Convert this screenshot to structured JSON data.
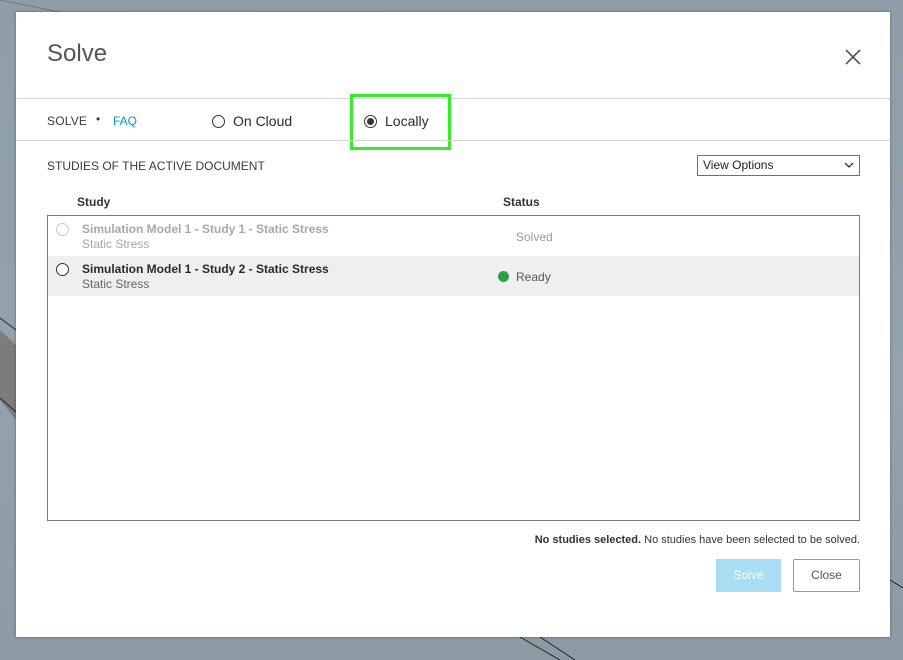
{
  "dialog": {
    "title": "Solve",
    "close_icon": "close-icon"
  },
  "mode_bar": {
    "solve_label": "SOLVE",
    "separator": "•",
    "faq_label": "FAQ",
    "options": [
      {
        "label": "On Cloud",
        "checked": false
      },
      {
        "label": "Locally",
        "checked": true
      }
    ]
  },
  "studies": {
    "section_title": "STUDIES OF THE ACTIVE DOCUMENT",
    "view_options": "View Options",
    "columns": {
      "study": "Study",
      "status": "Status"
    },
    "rows": [
      {
        "name": "Simulation Model 1 - Study 1 - Static Stress",
        "type": "Static Stress",
        "status": "Solved",
        "enabled": false,
        "selected": false
      },
      {
        "name": "Simulation Model 1 - Study 2 - Static Stress",
        "type": "Static Stress",
        "status": "Ready",
        "enabled": true,
        "selected": false,
        "status_color": "#2ea043"
      }
    ]
  },
  "footer": {
    "message_bold": "No studies selected.",
    "message_rest": " No studies have been selected to be solved.",
    "solve_label": "Solve",
    "close_label": "Close"
  },
  "colors": {
    "accent": "#0696d7",
    "highlight": "#33ee22",
    "solve_disabled": "#a9ddf3"
  }
}
